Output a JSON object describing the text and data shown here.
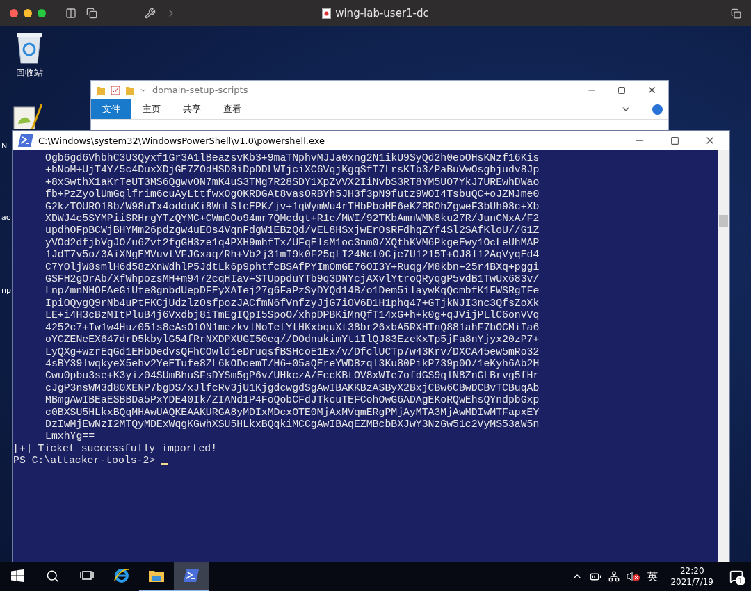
{
  "host_window": {
    "title": "wing-lab-user1-dc"
  },
  "desktop_icons": [
    {
      "kind": "recycle",
      "label": "回收站"
    },
    {
      "kind": "notepad",
      "label": "N"
    },
    {
      "kind": "plain",
      "label": "ac"
    },
    {
      "kind": "plain",
      "label": "np"
    }
  ],
  "explorer": {
    "title": "domain-setup-scripts",
    "ribbon_tabs": [
      {
        "label": "文件",
        "selected": true
      },
      {
        "label": "主页",
        "selected": false
      },
      {
        "label": "共享",
        "selected": false
      },
      {
        "label": "查看",
        "selected": false
      }
    ]
  },
  "powershell": {
    "title": "C:\\Windows\\system32\\WindowsPowerShell\\v1.0\\powershell.exe",
    "output_lines": [
      "Ogb6gd6VhbhC3U3Qyxf1Gr3A1lBeazsvKb3+9maTNphvMJJa0xng2N1ikU9SyQd2h0eoOHsKNzf16Kis",
      "+bNoM+UjT4Y/5c4DuxXDjGE7ZOdHSD8iDpDDLWIjciXC6VqjKgqSfT7LrsKIb3/PaBuVwOsgbjudv8Jp",
      "+8xSwthX1aKrTeUT3MS6QgwvON7mK4uS3TMg7R28SDY1XpZvVX2IiNvbS3RT8YM5UO7YkJ7UREwhDWao",
      "fb+PzZyolUmGqlfrim6cuAyLttfwxOgOKRDGAt8vasORBYh5JH3f3pN9futz9WOI4TsbuQC+oJZMJme0",
      "G2kzTOURO18b/W98uTx4odduKi8WnLSlcEPK/jv+1qWymWu4rTHbPboHE6eKZRROhZgweF3bUh98c+Xb",
      "XDWJ4c5SYMPiiSRHrgYTzQYMC+CWmGOo94mr7QMcdqt+R1e/MWI/92TKbAmnWMN8ku27R/JunCNxA/F2",
      "updhOFpBCWjBHYMm26pdzgw4uEOs4VqnFdgW1EBzQd/vEL8HSxjwErOsRFdhqZYf4Sl2SAfKloU//G1Z",
      "yVOd2dfjbVgJO/u6Zvt2fgGH3ze1q4PXH9mhfTx/UFqElsM1oc3nm0/XQthKVM6PkgeEwy1OcLeUhMAP",
      "1JdT7v5o/3AiXNgEMVuvtVFJGxaq/Rh+Vb2j31mI9k0F25qLI24Nct0Cje7U1215T+OJ8l12AqVyqEd4",
      "C7YOljW8smlH6d58zXnWdhlP5JdtLk6p9phtfcBSAfPYImOmGE76OI3Y+Ruqg/M8kbn+25r4BXq+pggi",
      "GSFH2gOrAb/XfWhpozsMH+m9472cqHIav+STUppduYTb9q3DNYcjAXvlYtroQRyqgP5vdB1TwUx683v/",
      "Lnp/mnNHOFAeGiUte8gnbdUepDFEyXAIej27g6FaPzSyDYQd14B/o1Dem5ilaywKqQcmbfK1FWSRgTFe",
      "IpiOQygQ9rNb4uPtFKCjUdzlzOsfpozJACfmN6fVnfzyJjG7iOV6D1H1phq47+GTjkNJI3nc3QfsZoXk",
      "LE+i4H3cBzMItPluB4j6Vxdbj8iTmEgIQpI5SpoO/xhpDPBKiMnQfT14xG+h+k0g+qJVijPLlC6onVVq",
      "4252c7+Iw1w4Huz051s8eAsO1ON1mezkvlNoTetYtHKxbquXt38br26xbA5RXHTnQ881ahF7bOCMiIa6",
      "oYCZENeEX647drD5kbylG54fRrNXDPXUGI50eq//DOdnukimYt1IlQJ83EzeKxTp5jFa8nYjyx20zP7+",
      "LyQXg+wzrEqGd1EHbDedvsQFhCOwld1eDruqsfBSHcoE1Ex/v/DfclUCTp7w43Krv/DXCA45ew5mRo32",
      "4sBY39lwqkyeX5ehv2YeETufe8ZL6kODoemT/H6+05aQEreYWD8zql3Ku80PikP739p0O/1eKyh6Ab2H",
      "Cwu0pbu3se+K3yiz04SUmBhuSFsDYSm5gP6v/UHkczA/EccKBtOV8xWIe7ofdGS9qlN8ZnGLBrvg5fHr",
      "cJgP3nsWM3d80XENP7bgDS/xJlfcRv3jU1KjgdcwgdSgAwIBAKKBzASByX2BxjCBw6CBwDCBvTCBuqAb",
      "MBmgAwIBEaESBBDa5PxYDE40Ik/ZIANd1P4FoQobCFdJTkcuTEFCohOwG6ADAgEKoRQwEhsQYndpbGxp",
      "c0BXSU5HLkxBQqMHAwUAQKEAAKURGA8yMDIxMDcxOTE0MjAxMVqmERgPMjAyMTA3MjAwMDIwMTFapxEY",
      "DzIwMjEwNzI2MTQyMDExWqgKGwhXSU5HLkxBQqkiMCCgAwIBAqEZMBcbBXJwY3NzGw51c2VyMS53aW5n",
      "LmxhYg=="
    ],
    "status_line": "[+] Ticket successfully imported!",
    "prompt": "PS C:\\attacker-tools-2>"
  },
  "taskbar": {
    "apps": [
      {
        "kind": "start",
        "running": false,
        "selected": false
      },
      {
        "kind": "search",
        "running": false,
        "selected": false
      },
      {
        "kind": "taskview",
        "running": false,
        "selected": false
      },
      {
        "kind": "ie",
        "running": false,
        "selected": false
      },
      {
        "kind": "explorer",
        "running": true,
        "selected": false
      },
      {
        "kind": "powershell",
        "running": true,
        "selected": true
      }
    ],
    "language": "英",
    "time": "22:20",
    "date": "2021/7/19",
    "notification_count": "1"
  }
}
